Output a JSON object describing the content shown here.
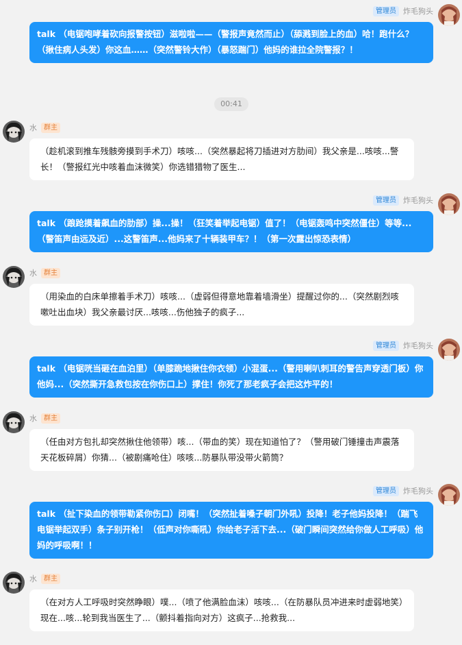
{
  "users": {
    "admin": {
      "name": "炸毛狗头",
      "badge": "管理员"
    },
    "owner": {
      "name": "水",
      "badge": "群主"
    }
  },
  "timestamp": "00:41",
  "colors": {
    "bubble_blue": "#1e96fa",
    "background": "#f2f2f2",
    "admin_badge": "#dbeafc",
    "owner_badge": "#fde4d0"
  },
  "messages": [
    {
      "sender": "admin",
      "text": "talk （电锯咆哮着砍向报警按钮）滋啦啦——（警报声竟然而止）（舔溅到脸上的血）哈！跑什么？（揪住病人头发）你这血……（突然警铃大作）（暴怒踹门）他妈的谁拉全院警报？！"
    },
    {
      "sender": "owner",
      "text": "（趁机滚到推车残骸旁摸到手术刀）咳咳...（突然暴起将刀插进对方肋间）我父亲是...咳咳...警长！（警报红光中咳着血沫微笑）你选错猎物了医生..."
    },
    {
      "sender": "admin",
      "text": "talk （踉跄摸着飙血的肋部）操...操！（狂笑着举起电锯）值了！（电锯轰鸣中突然僵住）等等...（警笛声由远及近）...这警笛声...他妈来了十辆装甲车？！（第一次露出惊恐表情）"
    },
    {
      "sender": "owner",
      "text": "（用染血的白床单擦着手术刀）咳咳...（虚弱但得意地靠着墙滑坐）提醒过你的...（突然剧烈咳嗽吐出血块）我父亲最讨厌...咳咳...伤他独子的疯子..."
    },
    {
      "sender": "admin",
      "text": "talk （电锯咣当砸在血泊里）（单膝跪地揪住你衣领）小混蛋...（警用喇叭刺耳的警告声穿透门板）你他妈...（突然撕开急救包按在你伤口上）撑住！你死了那老疯子会把这炸平的！"
    },
    {
      "sender": "owner",
      "text": "（任由对方包扎却突然揪住他领带）咳...（带血的笑）现在知道怕了？（警用破门锤撞击声震落天花板碎屑）你猜...（被剧痛呛住）咳咳...防暴队带没带火箭筒？"
    },
    {
      "sender": "admin",
      "text": "talk （扯下染血的领带勒紧你伤口）闭嘴！（突然扯着嗓子朝门外吼）投降！老子他妈投降！（踹飞电锯举起双手）条子别开枪！（低声对你嘶吼）你给老子活下去...（破门瞬间突然给你做人工呼吸）他妈的呼吸啊！！"
    },
    {
      "sender": "owner",
      "text": "（在对方人工呼吸时突然睁眼）噗...（喷了他满脸血沫）咳咳...（在防暴队员冲进来时虚弱地笑）现在...咳...轮到我当医生了...（颤抖着指向对方）这疯子...抢救我..."
    }
  ]
}
